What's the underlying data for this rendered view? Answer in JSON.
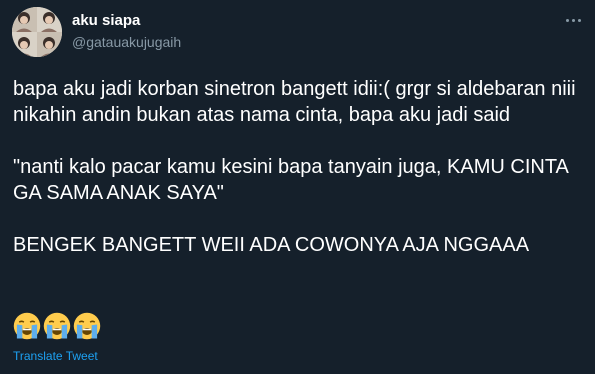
{
  "colors": {
    "background": "#15202b",
    "text": "#ffffff",
    "secondary_text": "#8899a6",
    "link": "#1da1f2"
  },
  "user": {
    "display_name": "aku siapa",
    "handle": "@gatauakujugaih",
    "avatar_icon": "profile-avatar"
  },
  "tweet": {
    "paragraphs": [
      "bapa aku jadi korban sinetron bangett idii:( grgr si aldebaran niii nikahin andin bukan atas nama cinta, bapa aku jadi said",
      "\"nanti kalo pacar kamu kesini bapa tanyain juga, KAMU CINTA GA SAMA ANAK SAYA\"",
      "BENGEK BANGETT WEII ADA COWONYA AJA NGGAAA"
    ],
    "emojis": [
      "loudly-crying-face",
      "loudly-crying-face",
      "loudly-crying-face"
    ]
  },
  "actions": {
    "more_icon": "more-options-icon",
    "translate_label": "Translate Tweet"
  }
}
